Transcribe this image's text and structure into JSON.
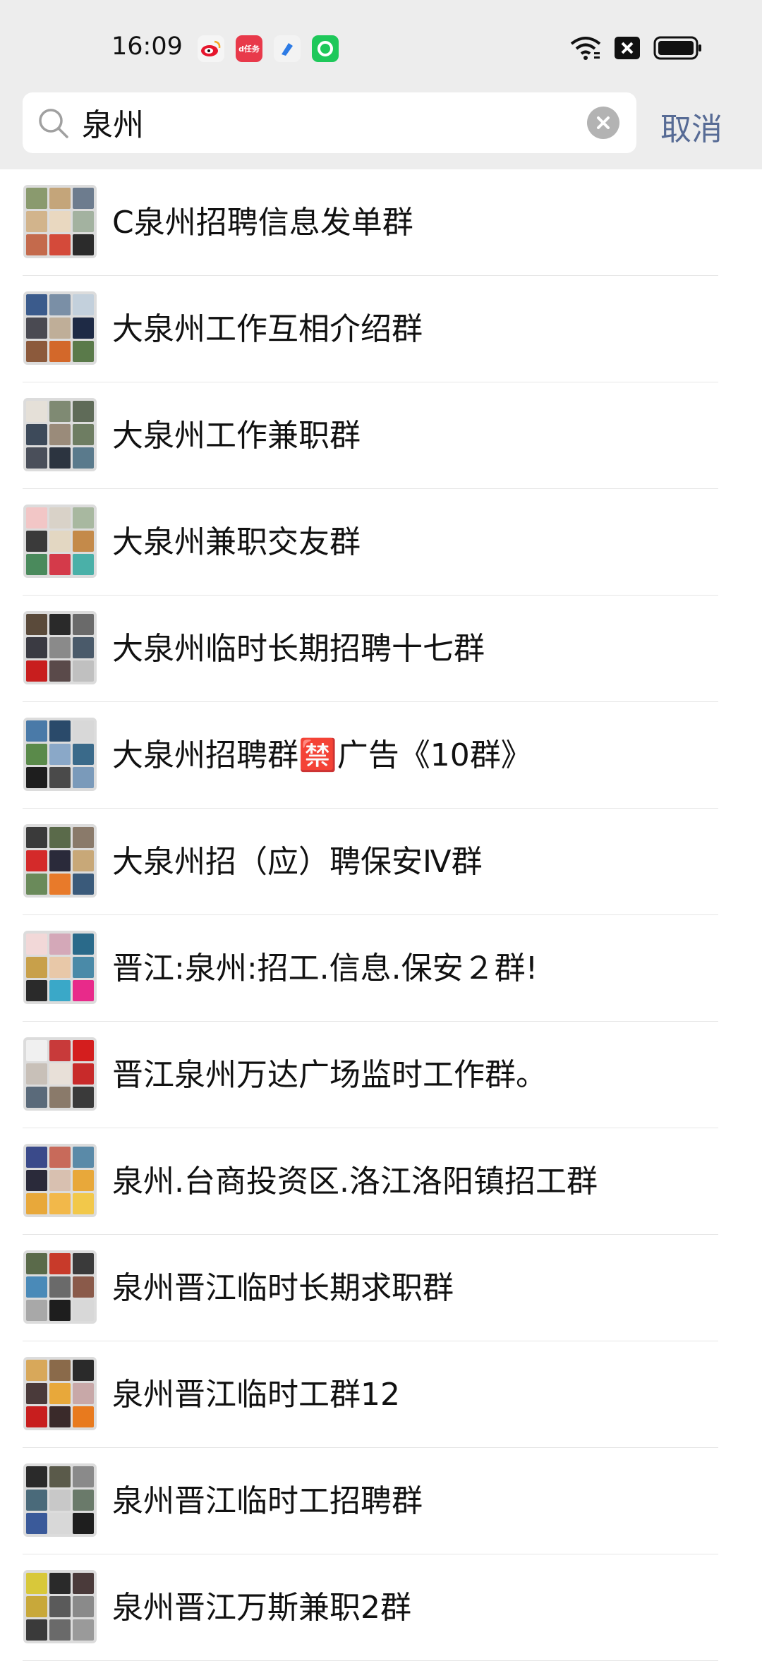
{
  "status_bar": {
    "time": "16:09",
    "notifications": [
      {
        "icon": "weibo-icon",
        "color": "#f5a623"
      },
      {
        "icon": "red-app-icon",
        "color": "#e8394a",
        "label": "d任务"
      },
      {
        "icon": "blue-app-icon",
        "color": "#3a8ee6"
      },
      {
        "icon": "green-app-icon",
        "color": "#1ec85a"
      }
    ]
  },
  "search": {
    "query": "泉州",
    "cancel_label": "取消"
  },
  "results": [
    {
      "name": "C泉州招聘信息发单群",
      "colors": [
        "#8a9a6e",
        "#c4a57a",
        "#6d7c8e",
        "#d2b48c",
        "#e9d8c0",
        "#a3b2a0",
        "#c46a4c",
        "#d44a3a",
        "#2b2b2b"
      ]
    },
    {
      "name": "大泉州工作互相介绍群",
      "colors": [
        "#3b5b8c",
        "#7a8fa6",
        "#c3d0dc",
        "#4a4a52",
        "#bfae98",
        "#1e2a45",
        "#8c5a3c",
        "#d3682a",
        "#5a7a4a"
      ]
    },
    {
      "name": "大泉州工作兼职群",
      "colors": [
        "#e5e0d8",
        "#7f8a73",
        "#5f6b58",
        "#3d4a5a",
        "#9a8b7a",
        "#6e7d62",
        "#4a4f5a",
        "#2c3440",
        "#5a7a8c"
      ]
    },
    {
      "name": "大泉州兼职交友群",
      "colors": [
        "#f2c6c6",
        "#d9d2c8",
        "#a8b8a0",
        "#3a3a3a",
        "#e3d7c2",
        "#c48a4a",
        "#4a8a5c",
        "#d43a4a",
        "#4ab0a8"
      ]
    },
    {
      "name": "大泉州临时长期招聘十七群",
      "colors": [
        "#5a4a3a",
        "#2a2a2a",
        "#6a6a6a",
        "#3a3a42",
        "#8a8a8a",
        "#4a5a6a",
        "#c81e1e",
        "#5a4a4a",
        "#c0c0c0"
      ]
    },
    {
      "name": "大泉州招聘群🈲广告《10群》",
      "colors": [
        "#4a7aa8",
        "#2a4a6a",
        "#d8d8d8",
        "#5a8a4a",
        "#8aa8c8",
        "#3a6a8a",
        "#1e1e1e",
        "#4a4a4a",
        "#7a9aba"
      ]
    },
    {
      "name": "大泉州招（应）聘保安Ⅳ群",
      "colors": [
        "#3a3a3a",
        "#5a6a4a",
        "#8a7a6a",
        "#d42a2a",
        "#2a2a3a",
        "#c8a878",
        "#6a8a5a",
        "#e87a2a",
        "#3a5a7a"
      ]
    },
    {
      "name": "晋江:泉州:招工.信息.保安２群!",
      "colors": [
        "#f2d8d8",
        "#d4a8b8",
        "#2a6a8a",
        "#c8a04a",
        "#e8c8a8",
        "#4a8aa8",
        "#2a2a2a",
        "#3aa8c8",
        "#e82a8a"
      ]
    },
    {
      "name": "晋江泉州万达广场监时工作群。",
      "colors": [
        "#f0f0f0",
        "#c83a3a",
        "#d41e1e",
        "#c8c0b8",
        "#e8e0d8",
        "#c82a2a",
        "#5a6a7a",
        "#8a7a6a",
        "#3a3a3a"
      ]
    },
    {
      "name": "泉州.台商投资区.洛江洛阳镇招工群",
      "colors": [
        "#3a4a8a",
        "#c86a5a",
        "#5a8aa8",
        "#2a2a3a",
        "#d8c0b0",
        "#e8a83a",
        "#e8a83a",
        "#f2b84a",
        "#f2c84a"
      ]
    },
    {
      "name": "泉州晋江临时长期求职群",
      "colors": [
        "#5a6a4a",
        "#c83a2a",
        "#3a3a3a",
        "#4a8ab8",
        "#6a6a6a",
        "#8a5a4a",
        "#a8a8a8",
        "#1e1e1e",
        "#d8d8d8"
      ]
    },
    {
      "name": "泉州晋江临时工群12",
      "colors": [
        "#d8a85a",
        "#8a6a4a",
        "#2a2a2a",
        "#4a3a3a",
        "#e8a83a",
        "#c8a8a8",
        "#c81e1e",
        "#3a2a2a",
        "#e87a1e"
      ]
    },
    {
      "name": "泉州晋江临时工招聘群",
      "colors": [
        "#2a2a2a",
        "#5a5a4a",
        "#8a8a8a",
        "#4a6a7a",
        "#c8c8c8",
        "#6a7a6a",
        "#3a5a9a",
        "#d8d8d8",
        "#1e1e1e"
      ]
    },
    {
      "name": "泉州晋江万斯兼职2群",
      "colors": [
        "#d8c83a",
        "#2a2a2a",
        "#4a3a3a",
        "#c8a83a",
        "#5a5a5a",
        "#8a8a8a",
        "#3a3a3a",
        "#6a6a6a",
        "#9a9a9a"
      ]
    }
  ]
}
